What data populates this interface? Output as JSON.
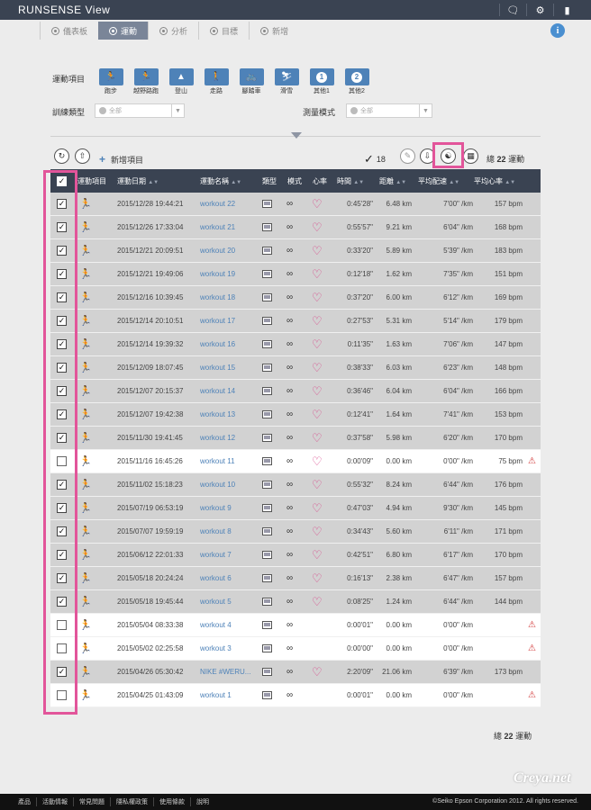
{
  "app": {
    "title": "RUNSENSE View"
  },
  "topbar": {
    "icons": [
      "chat-icon",
      "gear-icon",
      "door-icon"
    ]
  },
  "nav": {
    "tabs": [
      {
        "label": "儀表板",
        "active": false
      },
      {
        "label": "運動",
        "active": true
      },
      {
        "label": "分析",
        "active": false
      },
      {
        "label": "目標",
        "active": false
      },
      {
        "label": "新增",
        "active": false
      }
    ]
  },
  "filters": {
    "sport_label": "運動項目",
    "sports": [
      {
        "label": "跑步",
        "icon": "run-icon"
      },
      {
        "label": "越野路跑",
        "icon": "trail-run-icon"
      },
      {
        "label": "登山",
        "icon": "mountain-icon"
      },
      {
        "label": "走路",
        "icon": "walk-icon"
      },
      {
        "label": "腳踏車",
        "icon": "bike-icon"
      },
      {
        "label": "滑雪",
        "icon": "ski-icon"
      },
      {
        "label": "其他1",
        "icon": "other1-icon"
      },
      {
        "label": "其他2",
        "icon": "other2-icon"
      }
    ],
    "training_label": "訓練類型",
    "training_value": "全部",
    "measure_label": "測量模式",
    "measure_value": "全部"
  },
  "toolbar": {
    "add_label": "新增項目",
    "check_count": "18",
    "total_label": "總",
    "total_count": "22",
    "total_unit": "運動"
  },
  "table": {
    "headers": [
      "運動項目",
      "運動日期",
      "運動名稱",
      "類型",
      "模式",
      "心率",
      "時間",
      "距離",
      "平均配速",
      "平均心率"
    ],
    "rows": [
      {
        "checked": true,
        "date": "2015/12/28  19:44:21",
        "name": "workout 22",
        "hr": true,
        "time": "0:45'28\"",
        "dist": "6.48 km",
        "pace": "7'00\" /km",
        "bpm": "157 bpm",
        "warn": false
      },
      {
        "checked": true,
        "date": "2015/12/26  17:33:04",
        "name": "workout 21",
        "hr": true,
        "time": "0:55'57\"",
        "dist": "9.21 km",
        "pace": "6'04\" /km",
        "bpm": "168 bpm",
        "warn": false
      },
      {
        "checked": true,
        "date": "2015/12/21  20:09:51",
        "name": "workout 20",
        "hr": true,
        "time": "0:33'20\"",
        "dist": "5.89 km",
        "pace": "5'39\" /km",
        "bpm": "183 bpm",
        "warn": false
      },
      {
        "checked": true,
        "date": "2015/12/21  19:49:06",
        "name": "workout 19",
        "hr": true,
        "time": "0:12'18\"",
        "dist": "1.62 km",
        "pace": "7'35\" /km",
        "bpm": "151 bpm",
        "warn": false
      },
      {
        "checked": true,
        "date": "2015/12/16  10:39:45",
        "name": "workout 18",
        "hr": true,
        "time": "0:37'20\"",
        "dist": "6.00 km",
        "pace": "6'12\" /km",
        "bpm": "169 bpm",
        "warn": false
      },
      {
        "checked": true,
        "date": "2015/12/14  20:10:51",
        "name": "workout 17",
        "hr": true,
        "time": "0:27'53\"",
        "dist": "5.31 km",
        "pace": "5'14\" /km",
        "bpm": "179 bpm",
        "warn": false
      },
      {
        "checked": true,
        "date": "2015/12/14  19:39:32",
        "name": "workout 16",
        "hr": true,
        "time": "0:11'35\"",
        "dist": "1.63 km",
        "pace": "7'06\" /km",
        "bpm": "147 bpm",
        "warn": false
      },
      {
        "checked": true,
        "date": "2015/12/09  18:07:45",
        "name": "workout 15",
        "hr": true,
        "time": "0:38'33\"",
        "dist": "6.03 km",
        "pace": "6'23\" /km",
        "bpm": "148 bpm",
        "warn": false
      },
      {
        "checked": true,
        "date": "2015/12/07  20:15:37",
        "name": "workout 14",
        "hr": true,
        "time": "0:36'46\"",
        "dist": "6.04 km",
        "pace": "6'04\" /km",
        "bpm": "166 bpm",
        "warn": false
      },
      {
        "checked": true,
        "date": "2015/12/07  19:42:38",
        "name": "workout 13",
        "hr": true,
        "time": "0:12'41\"",
        "dist": "1.64 km",
        "pace": "7'41\" /km",
        "bpm": "153 bpm",
        "warn": false
      },
      {
        "checked": true,
        "date": "2015/11/30  19:41:45",
        "name": "workout 12",
        "hr": true,
        "time": "0:37'58\"",
        "dist": "5.98 km",
        "pace": "6'20\" /km",
        "bpm": "170 bpm",
        "warn": false
      },
      {
        "checked": false,
        "date": "2015/11/16  16:45:26",
        "name": "workout 11",
        "hr": true,
        "time": "0:00'09\"",
        "dist": "0.00 km",
        "pace": "0'00\" /km",
        "bpm": "75 bpm",
        "warn": true
      },
      {
        "checked": true,
        "date": "2015/11/02  15:18:23",
        "name": "workout 10",
        "hr": true,
        "time": "0:55'32\"",
        "dist": "8.24 km",
        "pace": "6'44\" /km",
        "bpm": "176 bpm",
        "warn": false
      },
      {
        "checked": true,
        "date": "2015/07/19  06:53:19",
        "name": "workout 9",
        "hr": true,
        "time": "0:47'03\"",
        "dist": "4.94 km",
        "pace": "9'30\" /km",
        "bpm": "145 bpm",
        "warn": false
      },
      {
        "checked": true,
        "date": "2015/07/07  19:59:19",
        "name": "workout 8",
        "hr": true,
        "time": "0:34'43\"",
        "dist": "5.60 km",
        "pace": "6'11\" /km",
        "bpm": "171 bpm",
        "warn": false
      },
      {
        "checked": true,
        "date": "2015/06/12  22:01:33",
        "name": "workout 7",
        "hr": true,
        "time": "0:42'51\"",
        "dist": "6.80 km",
        "pace": "6'17\" /km",
        "bpm": "170 bpm",
        "warn": false
      },
      {
        "checked": true,
        "date": "2015/05/18  20:24:24",
        "name": "workout 6",
        "hr": true,
        "time": "0:16'13\"",
        "dist": "2.38 km",
        "pace": "6'47\" /km",
        "bpm": "157 bpm",
        "warn": false
      },
      {
        "checked": true,
        "date": "2015/05/18  19:45:44",
        "name": "workout 5",
        "hr": true,
        "time": "0:08'25\"",
        "dist": "1.24 km",
        "pace": "6'44\" /km",
        "bpm": "144 bpm",
        "warn": false
      },
      {
        "checked": false,
        "date": "2015/05/04  08:33:38",
        "name": "workout 4",
        "hr": false,
        "time": "0:00'01\"",
        "dist": "0.00 km",
        "pace": "0'00\" /km",
        "bpm": "",
        "warn": true
      },
      {
        "checked": false,
        "date": "2015/05/02  02:25:58",
        "name": "workout 3",
        "hr": false,
        "time": "0:00'00\"",
        "dist": "0.00 km",
        "pace": "0'00\" /km",
        "bpm": "",
        "warn": true
      },
      {
        "checked": true,
        "date": "2015/04/26  05:30:42",
        "name": "NIKE #WERU...",
        "hr": true,
        "time": "2:20'09\"",
        "dist": "21.06 km",
        "pace": "6'39\" /km",
        "bpm": "173 bpm",
        "warn": false
      },
      {
        "checked": false,
        "date": "2015/04/25  01:43:09",
        "name": "workout 1",
        "hr": false,
        "time": "0:00'01\"",
        "dist": "0.00 km",
        "pace": "0'00\" /km",
        "bpm": "",
        "warn": true
      }
    ]
  },
  "footer": {
    "links": [
      "產品",
      "活動情報",
      "常見問題",
      "隱私權政策",
      "使用條款",
      "說明"
    ],
    "copyright": "©Seiko Epson Corporation 2012. All rights reserved."
  },
  "watermark": "Creya.net",
  "colors": {
    "accent": "#4e82b8",
    "highlight": "#e2559a",
    "heart": "#d9468a",
    "header": "#3a4352"
  }
}
